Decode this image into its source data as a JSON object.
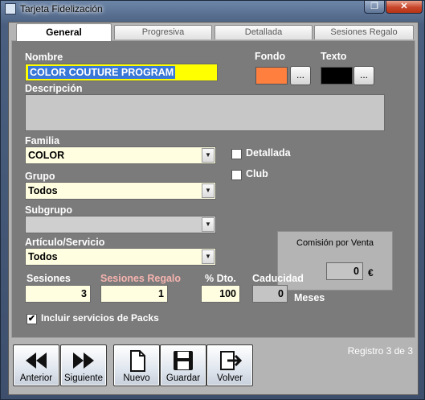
{
  "window": {
    "title": "Tarjeta Fidelización"
  },
  "tabs": [
    {
      "label": "General",
      "active": true
    },
    {
      "label": "Progresiva",
      "active": false
    },
    {
      "label": "Detallada",
      "active": false
    },
    {
      "label": "Sesiones Regalo",
      "active": false
    }
  ],
  "form": {
    "nombre": {
      "label": "Nombre",
      "value": "COLOR COUTURE PROGRAM"
    },
    "fondo": {
      "label": "Fondo",
      "color": "#ff7f3f",
      "button": "..."
    },
    "texto": {
      "label": "Texto",
      "color": "#000000",
      "button": "..."
    },
    "descripcion": {
      "label": "Descripción",
      "value": ""
    },
    "familia": {
      "label": "Familia",
      "value": "COLOR"
    },
    "grupo": {
      "label": "Grupo",
      "value": "Todos"
    },
    "subgrupo": {
      "label": "Subgrupo",
      "value": ""
    },
    "articulo": {
      "label": "Artículo/Servicio",
      "value": "Todos"
    },
    "detallada": {
      "label": "Detallada",
      "checked": false
    },
    "club": {
      "label": "Club",
      "checked": false
    },
    "comision": {
      "label": "Comisión por Venta",
      "value": "0",
      "unit": "€"
    },
    "sesiones": {
      "label": "Sesiones",
      "value": "3"
    },
    "sesiones_regalo": {
      "label": "Sesiones Regalo",
      "value": "1"
    },
    "dto": {
      "label": "% Dto.",
      "value": "100"
    },
    "caducidad": {
      "label": "Caducidad",
      "value": "0",
      "unit": "Meses"
    },
    "incluir_packs": {
      "label": "Incluir servicios de Packs",
      "checked": true
    }
  },
  "toolbar": {
    "anterior": "Anterior",
    "siguiente": "Siguiente",
    "nuevo": "Nuevo",
    "guardar": "Guardar",
    "volver": "Volver"
  },
  "status": {
    "registro": "Registro 3 de 3"
  },
  "colors": {
    "accent": "#3a78d8",
    "panel": "#7b7b7b",
    "input_bg": "#fffee0",
    "pink_label": "#f5b3ae"
  }
}
